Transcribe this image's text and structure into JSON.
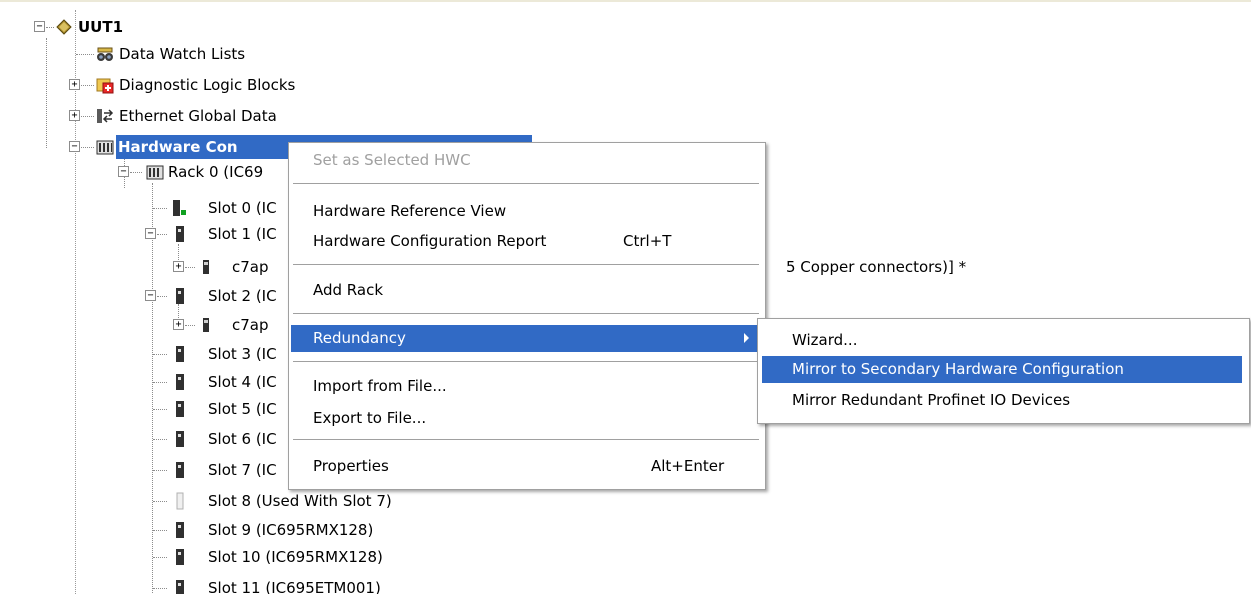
{
  "tree": {
    "root": {
      "label": "UUT1"
    },
    "data_watch": {
      "label": "Data Watch Lists"
    },
    "diag_logic": {
      "label": "Diagnostic Logic Blocks"
    },
    "egd": {
      "label": "Ethernet Global Data"
    },
    "hwc": {
      "label": "Hardware Con",
      "trailing": "...."
    },
    "rack0": {
      "label": "Rack 0 (IC69"
    },
    "slot0": {
      "label": "Slot 0 (IC"
    },
    "slot1": {
      "label": "Slot 1 (IC"
    },
    "c7ap1": {
      "label": "c7ap",
      "trailing": "5 Copper connectors)] *"
    },
    "slot2": {
      "label": "Slot 2 (IC"
    },
    "c7ap2": {
      "label": "c7ap"
    },
    "slot3": {
      "label": "Slot 3 (IC"
    },
    "slot4": {
      "label": "Slot 4 (IC"
    },
    "slot5": {
      "label": "Slot 5 (IC"
    },
    "slot6": {
      "label": "Slot 6 (IC"
    },
    "slot7": {
      "label": "Slot 7 (IC"
    },
    "slot8": {
      "label": "Slot 8 (Used With Slot 7)"
    },
    "slot9": {
      "label": "Slot 9 (IC695RMX128)"
    },
    "slot10": {
      "label": "Slot 10 (IC695RMX128)"
    },
    "slot11": {
      "label": "Slot 11 (IC695ETM001)"
    }
  },
  "context_menu": {
    "set_selected_hwc": "Set as Selected HWC",
    "hw_reference_view": "Hardware Reference View",
    "hw_config_report": "Hardware Configuration Report",
    "hw_config_report_shortcut": "Ctrl+T",
    "add_rack": "Add Rack",
    "redundancy": "Redundancy",
    "import_file": "Import from File...",
    "export_file": "Export to File...",
    "properties": "Properties",
    "properties_shortcut": "Alt+Enter"
  },
  "submenu": {
    "wizard": "Wizard...",
    "mirror_secondary": "Mirror to Secondary Hardware Configuration",
    "mirror_profinet": "Mirror Redundant Profinet IO Devices"
  },
  "colors": {
    "selection": "#316ac5",
    "disabled_text": "#a0a0a0"
  }
}
